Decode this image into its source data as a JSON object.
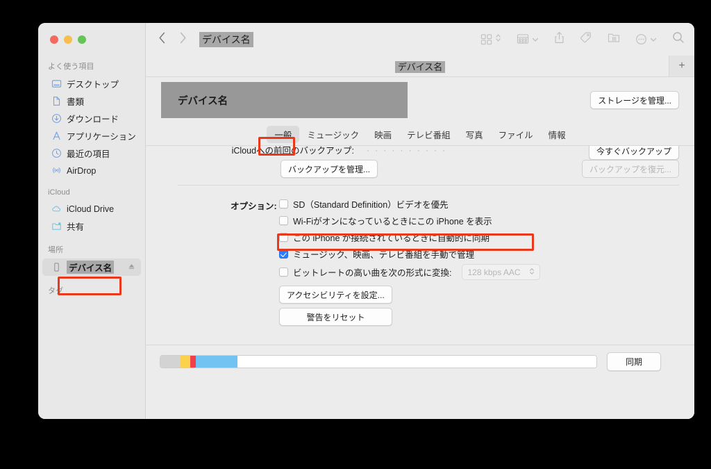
{
  "window": {
    "traffic_lights": [
      "close",
      "minimize",
      "maximize"
    ],
    "title_masked": "デバイス名"
  },
  "sidebar": {
    "groups": [
      {
        "title": "よく使う項目",
        "items": [
          {
            "label": "デスクトップ",
            "icon": "desktop-icon"
          },
          {
            "label": "書類",
            "icon": "document-icon"
          },
          {
            "label": "ダウンロード",
            "icon": "download-icon"
          },
          {
            "label": "アプリケーション",
            "icon": "applications-icon"
          },
          {
            "label": "最近の項目",
            "icon": "recents-clock-icon"
          },
          {
            "label": "AirDrop",
            "icon": "airdrop-icon"
          }
        ]
      },
      {
        "title": "iCloud",
        "items": [
          {
            "label": "iCloud Drive",
            "icon": "cloud-icon"
          },
          {
            "label": "共有",
            "icon": "shared-folder-icon"
          }
        ]
      },
      {
        "title": "場所",
        "items": [
          {
            "label": "デバイス名",
            "icon": "iphone-icon",
            "selected": true,
            "masked": true,
            "eject": true,
            "highlighted": true
          }
        ]
      },
      {
        "title": "タグ",
        "items": []
      }
    ]
  },
  "toolbar": {
    "back_label": "‹",
    "forward_label": "›",
    "path_title": "デバイス名",
    "icons": [
      "grid-view-icon",
      "view-sort-chevron-icon",
      "group-by-icon",
      "group-by-chevron-icon",
      "share-icon",
      "tag-icon",
      "folder-action-icon",
      "more-options-icon",
      "more-options-chevron-icon",
      "search-icon"
    ]
  },
  "tabstrip": {
    "title": "デバイス名",
    "new_tab_label": "+"
  },
  "device_header": {
    "device_name": "デバイス名",
    "manage_storage_label": "ストレージを管理..."
  },
  "tabs": [
    {
      "label": "一般",
      "active": true,
      "highlighted": true
    },
    {
      "label": "ミュージック",
      "active": false
    },
    {
      "label": "映画",
      "active": false
    },
    {
      "label": "テレビ番組",
      "active": false
    },
    {
      "label": "写真",
      "active": false
    },
    {
      "label": "ファイル",
      "active": false
    },
    {
      "label": "情報",
      "active": false
    }
  ],
  "backup": {
    "last_backup_label": "iCloudへの前回のバックアップ:",
    "last_backup_value": "· · · · · · · · · ·",
    "backup_now_label": "今すぐバックアップ",
    "manage_backups_label": "バックアップを管理...",
    "restore_backup_label": "バックアップを復元..."
  },
  "options": {
    "label": "オプション:",
    "checkboxes": [
      {
        "label": "SD（Standard Definition）ビデオを優先",
        "checked": false
      },
      {
        "label": "Wi-Fiがオンになっているときにこの iPhone を表示",
        "checked": false,
        "highlighted": true
      },
      {
        "label": "この iPhone が接続されているときに自動的に同期",
        "checked": false
      },
      {
        "label": "ミュージック、映画、テレビ番組を手動で管理",
        "checked": true
      },
      {
        "label": "ビットレートの高い曲を次の形式に変換:",
        "checked": false,
        "select_value": "128 kbps AAC",
        "select_disabled": true
      }
    ],
    "accessibility_button": "アクセシビリティを設定...",
    "reset_warnings_button": "警告をリセット"
  },
  "capacity": {
    "segments": [
      {
        "name": "system",
        "color": "#d4d3d4",
        "percent": 4.6
      },
      {
        "name": "audio",
        "color": "#fbd14e",
        "percent": 2.2
      },
      {
        "name": "photos",
        "color": "#f1404c",
        "percent": 1.4
      },
      {
        "name": "other",
        "color": "#72c3f2",
        "percent": 9.5
      },
      {
        "name": "free",
        "color": "#ffffff",
        "percent": 82.3
      }
    ],
    "sync_button": "同期"
  },
  "colors": {
    "accent_blue": "#2b7fff",
    "sidebar_icon_blue": "#6f9fe8",
    "annotation_red": "#e8391d",
    "mask_gray": "#989898"
  }
}
